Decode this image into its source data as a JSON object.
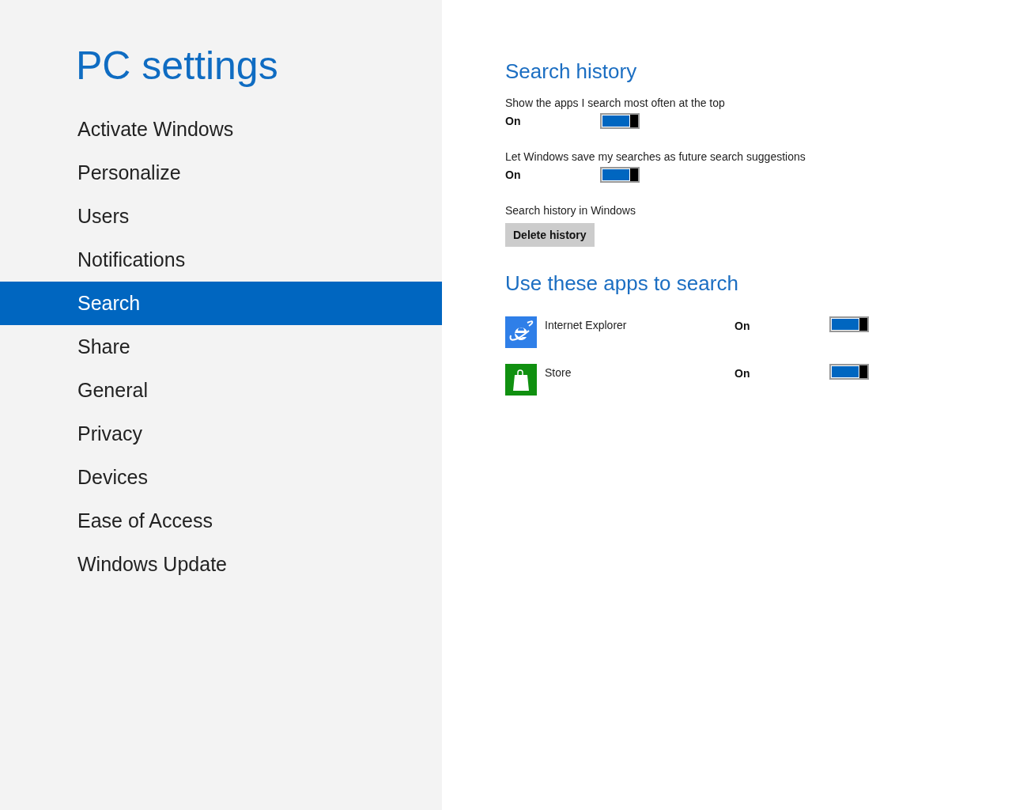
{
  "sidebar": {
    "title": "PC settings",
    "items": [
      {
        "label": "Activate Windows",
        "selected": false
      },
      {
        "label": "Personalize",
        "selected": false
      },
      {
        "label": "Users",
        "selected": false
      },
      {
        "label": "Notifications",
        "selected": false
      },
      {
        "label": "Search",
        "selected": true
      },
      {
        "label": "Share",
        "selected": false
      },
      {
        "label": "General",
        "selected": false
      },
      {
        "label": "Privacy",
        "selected": false
      },
      {
        "label": "Devices",
        "selected": false
      },
      {
        "label": "Ease of Access",
        "selected": false
      },
      {
        "label": "Windows Update",
        "selected": false
      }
    ]
  },
  "search_history": {
    "heading": "Search history",
    "settings": [
      {
        "label": "Show the apps I search most often at the top",
        "state_text": "On",
        "on": true
      },
      {
        "label": "Let Windows save my searches as future search suggestions",
        "state_text": "On",
        "on": true
      }
    ],
    "delete": {
      "label": "Search history in Windows",
      "button": "Delete history"
    }
  },
  "apps": {
    "heading": "Use these apps to search",
    "items": [
      {
        "kind": "browser",
        "name": "Internet Explorer",
        "state_text": "On",
        "on": true
      },
      {
        "kind": "store",
        "name": "Store",
        "state_text": "On",
        "on": true
      }
    ]
  }
}
